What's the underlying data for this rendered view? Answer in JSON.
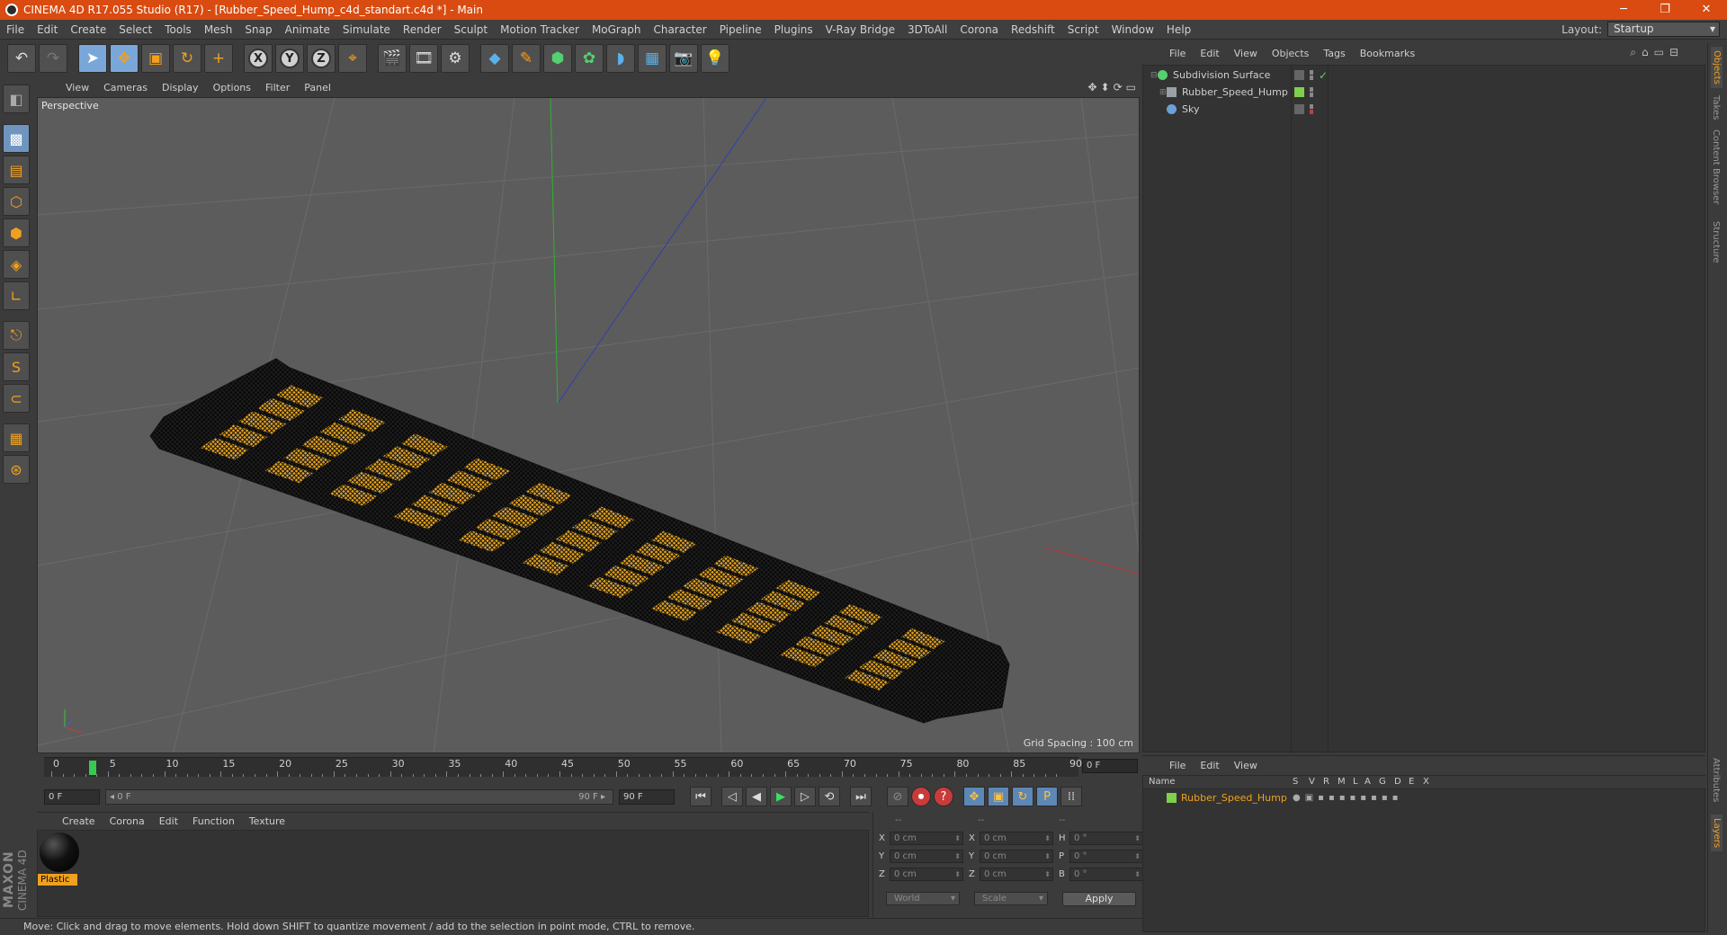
{
  "app": {
    "title": "CINEMA 4D R17.055 Studio (R17) - [Rubber_Speed_Hump_c4d_standart.c4d *] - Main",
    "minimize": "─",
    "restore": "❐",
    "close": "✕"
  },
  "menubar": [
    "File",
    "Edit",
    "Create",
    "Select",
    "Tools",
    "Mesh",
    "Snap",
    "Animate",
    "Simulate",
    "Render",
    "Sculpt",
    "Motion Tracker",
    "MoGraph",
    "Character",
    "Pipeline",
    "Plugins",
    "V-Ray Bridge",
    "3DToAll",
    "Corona",
    "Redshift",
    "Script",
    "Window",
    "Help"
  ],
  "layout": {
    "label": "Layout:",
    "value": "Startup"
  },
  "toolbar": {
    "undo": "↶",
    "redo": "↷",
    "select": "➤",
    "move": "✥",
    "scale": "▣",
    "rotate": "↻",
    "add": "+",
    "x": "X",
    "y": "Y",
    "z": "Z",
    "coords": "⌖",
    "render_view": "🎬",
    "render_pic": "🎞",
    "render_settings": "⚙",
    "cube": "◆",
    "pen": "✎",
    "subdiv": "⬢",
    "array": "✿",
    "deform": "◗",
    "floor": "▦",
    "camera": "📷",
    "light": "💡"
  },
  "lefttools": [
    "◧",
    "▩",
    "▤",
    "⬡",
    "⬢",
    "◈",
    "∟",
    "⎋",
    "S",
    "⊂",
    "▦",
    "⊛"
  ],
  "viewport": {
    "menu": [
      "View",
      "Cameras",
      "Display",
      "Options",
      "Filter",
      "Panel"
    ],
    "label": "Perspective",
    "grid_spacing": "Grid Spacing : 100 cm",
    "nav_icons": [
      "✥",
      "⬍",
      "⟳",
      "▭"
    ]
  },
  "timeline": {
    "ticks": [
      "0",
      "5",
      "10",
      "15",
      "20",
      "25",
      "30",
      "35",
      "40",
      "45",
      "50",
      "55",
      "60",
      "65",
      "70",
      "75",
      "80",
      "85",
      "90"
    ],
    "current_frame": "0 F",
    "start": "0 F",
    "range_start": "◂ 0 F",
    "range_end": "90 F ▸",
    "end": "90 F",
    "buttons": [
      "⏮",
      "◁",
      "◀",
      "▶",
      "▷",
      "⟲",
      "⏭"
    ]
  },
  "keyframe_buttons": [
    "⊘",
    "⏺",
    "?",
    "✥",
    "▣",
    "↻",
    "P",
    "⁞⁞"
  ],
  "materials": {
    "menu": [
      "Create",
      "Corona",
      "Edit",
      "Function",
      "Texture"
    ],
    "items": [
      {
        "name": "Plastic"
      }
    ]
  },
  "branding": {
    "maxon": "MAXON",
    "product": "CINEMA 4D"
  },
  "coordinates": {
    "headers": [
      "--",
      "--",
      "--"
    ],
    "rows": [
      {
        "a": "X",
        "v1": "0 cm",
        "b": "X",
        "v2": "0 cm",
        "c": "H",
        "v3": "0 °"
      },
      {
        "a": "Y",
        "v1": "0 cm",
        "b": "Y",
        "v2": "0 cm",
        "c": "P",
        "v3": "0 °"
      },
      {
        "a": "Z",
        "v1": "0 cm",
        "b": "Z",
        "v2": "0 cm",
        "c": "B",
        "v3": "0 °"
      }
    ],
    "mode1": "World",
    "mode2": "Scale",
    "apply": "Apply"
  },
  "status": "Move: Click and drag to move elements. Hold down SHIFT to quantize movement / add to the selection in point mode, CTRL to remove.",
  "object_manager": {
    "menu": [
      "File",
      "Edit",
      "View",
      "Objects",
      "Tags",
      "Bookmarks"
    ],
    "objects": [
      {
        "name": "Subdivision Surface",
        "icon_color": "#55d070",
        "check": "✓"
      },
      {
        "name": "Rubber_Speed_Hump",
        "icon_color": "#9aa0a6",
        "swatch": "#7fd04a"
      },
      {
        "name": "Sky",
        "icon_color": "#6aa0d8"
      }
    ]
  },
  "right_tabs": [
    "Objects",
    "Takes",
    "Content Browser",
    "Structure",
    "Attributes",
    "Layers"
  ],
  "layer_manager": {
    "menu": [
      "File",
      "Edit",
      "View"
    ],
    "columns": [
      "Name",
      "S",
      "V",
      "R",
      "M",
      "L",
      "A",
      "G",
      "D",
      "E",
      "X"
    ],
    "layers": [
      {
        "name": "Rubber_Speed_Hump",
        "color": "#7fd04a"
      }
    ]
  },
  "colors": {
    "accent": "#f0a020",
    "title_bar": "#d94b10",
    "hump_stripe": "#e8a21a",
    "hump_body": "#0a0a0a"
  }
}
